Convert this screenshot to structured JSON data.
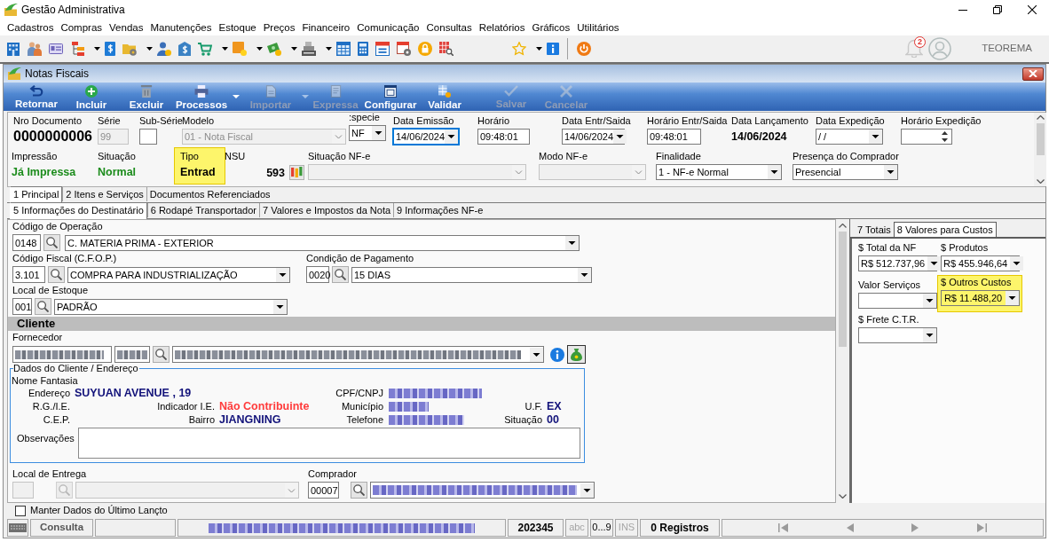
{
  "window": {
    "title": "Gestão Administrativa"
  },
  "menu": [
    "Cadastros",
    "Compras",
    "Vendas",
    "Manutenções",
    "Estoque",
    "Preços",
    "Financeiro",
    "Comunicação",
    "Consultas",
    "Relatórios",
    "Gráficos",
    "Utilitários"
  ],
  "notifications": {
    "count": "2"
  },
  "user": {
    "name": "TEOREMA"
  },
  "form": {
    "title": "Notas Fiscais",
    "toolbar": [
      {
        "label": "Retornar",
        "disabled": false,
        "dropdown": false
      },
      {
        "label": "Incluir",
        "disabled": false,
        "dropdown": false
      },
      {
        "label": "Excluir",
        "disabled": false,
        "dropdown": false
      },
      {
        "label": "Processos",
        "disabled": false,
        "dropdown": true
      },
      {
        "label": "Importar",
        "disabled": true,
        "dropdown": true
      },
      {
        "label": "Expressa",
        "disabled": true,
        "dropdown": false
      },
      {
        "label": "Configurar",
        "disabled": false,
        "dropdown": false
      },
      {
        "label": "Validar",
        "disabled": false,
        "dropdown": false
      },
      {
        "label": "Salvar",
        "disabled": true,
        "dropdown": false
      },
      {
        "label": "Cancelar",
        "disabled": true,
        "dropdown": false
      }
    ]
  },
  "header": {
    "row_1": [
      {
        "label": "Nro Documento",
        "kind": "number",
        "value": "0000000006",
        "disabled": false,
        "focused": false
      },
      {
        "label": "Série",
        "kind": "text",
        "value": "99",
        "disabled": true,
        "focused": false
      },
      {
        "label": "Sub-Série",
        "kind": "text",
        "disabled": false,
        "focused": false
      },
      {
        "label": "Modelo",
        "kind": "combo",
        "value": "01 - Nota Fiscal",
        "disabled": true,
        "focused": false
      },
      {
        "label": ":specie",
        "kind": "combo",
        "value": "NF",
        "disabled": false,
        "focused": false
      },
      {
        "label": "Data Emissão",
        "kind": "combo",
        "value": "14/06/2024",
        "disabled": false,
        "focused": true
      },
      {
        "label": "Horário",
        "kind": "text",
        "value": "09:48:01",
        "disabled": false,
        "focused": false
      },
      {
        "label": "Data Entr/Saida",
        "kind": "combo",
        "value": "14/06/2024",
        "disabled": false,
        "focused": false
      },
      {
        "label": "Horário Entr/Saida",
        "kind": "text",
        "value": "09:48:01",
        "disabled": false,
        "focused": false
      },
      {
        "label": "Data Lançamento",
        "kind": "value",
        "value": "14/06/2024",
        "disabled": false,
        "focused": false
      },
      {
        "label": "Data Expedição",
        "kind": "combo",
        "value": "/ /",
        "disabled": false,
        "focused": false
      },
      {
        "label": "Horário Expedição",
        "kind": "spin",
        "disabled": false,
        "focused": false
      }
    ],
    "row_2": [
      {
        "label": "Impressão",
        "kind": "status",
        "value": "Já Impressa",
        "disabled": false,
        "highlighted": false
      },
      {
        "label": "Situação",
        "kind": "status",
        "value": "Normal",
        "disabled": false,
        "highlighted": false
      },
      {
        "label": "Tipo",
        "kind": "value",
        "value": "Entrad",
        "disabled": false,
        "highlighted": true
      },
      {
        "label": "NSU",
        "kind": "sequence",
        "value": "593",
        "disabled": false,
        "highlighted": false
      },
      {
        "label": "Situação NF-e",
        "kind": "combo",
        "disabled": true,
        "highlighted": false
      },
      {
        "label": "Modo NF-e",
        "kind": "combo",
        "disabled": true,
        "highlighted": false
      },
      {
        "label": "Finalidade",
        "kind": "combo",
        "value": "1 - NF-e Normal",
        "disabled": false,
        "highlighted": false
      },
      {
        "label": "Presença do Comprador",
        "kind": "combo",
        "value": "Presencial",
        "disabled": false,
        "highlighted": false
      }
    ]
  },
  "tabs": [
    {
      "label": "1 Principal",
      "selected": true
    },
    {
      "label": "2 Itens e Serviços",
      "selected": false
    },
    {
      "label": "Documentos Referenciados",
      "selected": false
    }
  ],
  "subtabs": [
    {
      "label": "5 Informações do Destinatário",
      "selected": true
    },
    {
      "label": "6 Rodapé Transportador",
      "selected": false
    },
    {
      "label": "7 Valores e Impostos da Nota",
      "selected": false
    },
    {
      "label": "9 Informações NF-e",
      "selected": false
    }
  ],
  "operation": {
    "label": "Código de Operação",
    "code": "0148",
    "description": "C. MATERIA PRIMA - EXTERIOR"
  },
  "fiscal_code": {
    "label": "Código Fiscal (C.F.O.P.)",
    "code": "3.101",
    "description": "COMPRA PARA INDUSTRIALIZAÇÃO"
  },
  "payment_terms": {
    "label": "Condição de Pagamento",
    "code": "0020",
    "description": "15 DIAS"
  },
  "stock_location": {
    "label": "Local de Estoque",
    "code": "001",
    "description": "PADRÃO"
  },
  "section": {
    "title": "Cliente"
  },
  "supplier": {
    "label": "Fornecedor",
    "redacted": true
  },
  "address": {
    "title": "Dados do Cliente / Endereço",
    "trade_name_label": "Nome Fantasia",
    "rows": [
      [
        {
          "label": "Endereço",
          "kind": "value",
          "value": "SUYUAN AVENUE , 19"
        },
        "",
        {
          "label": "CPF/CNPJ",
          "kind": "redacted"
        }
      ],
      [
        {
          "label": "R.G./I.E.",
          "kind": "value"
        },
        {
          "label": "Indicador I.E.",
          "kind": "warning",
          "value": "Não Contribuinte"
        },
        {
          "label": "Município",
          "kind": "redacted"
        },
        {
          "label": "U.F.",
          "kind": "value",
          "value": "EX"
        }
      ],
      [
        {
          "label": "C.E.P.",
          "kind": "value"
        },
        {
          "label": "Bairro",
          "kind": "value",
          "value": "JIANGNING"
        },
        {
          "label": "Telefone",
          "kind": "redacted"
        },
        {
          "label": "Situação",
          "kind": "value",
          "value": "00"
        }
      ]
    ],
    "notes_label": "Observações"
  },
  "delivery": {
    "label": "Local de Entrega",
    "disabled": true
  },
  "buyer": {
    "label": "Comprador",
    "code": "00007",
    "redacted": true
  },
  "keep_data": {
    "label": "Manter Dados do Último Lançto",
    "checked": false
  },
  "costs": {
    "tabs": [
      {
        "label": "7 Totais",
        "selected": false
      },
      {
        "label": "8 Valores para Custos",
        "selected": true
      }
    ],
    "fields": [
      {
        "label": "$ Total da NF",
        "value": "R$ 512.737,96",
        "highlighted": false
      },
      {
        "label": "$ Produtos",
        "value": "R$ 455.946,64",
        "highlighted": false
      },
      {
        "label": "Valor Serviços",
        "highlighted": false
      },
      {
        "label": "$ Outros Custos",
        "value": "R$ 11.488,20",
        "highlighted": true
      },
      {
        "label": "$ Frete C.T.R.",
        "highlighted": false
      }
    ]
  },
  "status_bar": {
    "mode": "Consulta",
    "customer_redacted": true,
    "record": "202345",
    "indicators": [
      {
        "label": "abc",
        "on": false
      },
      {
        "label": "0...9",
        "on": true
      },
      {
        "label": "INS",
        "on": false
      }
    ],
    "records": "0 Registros"
  }
}
